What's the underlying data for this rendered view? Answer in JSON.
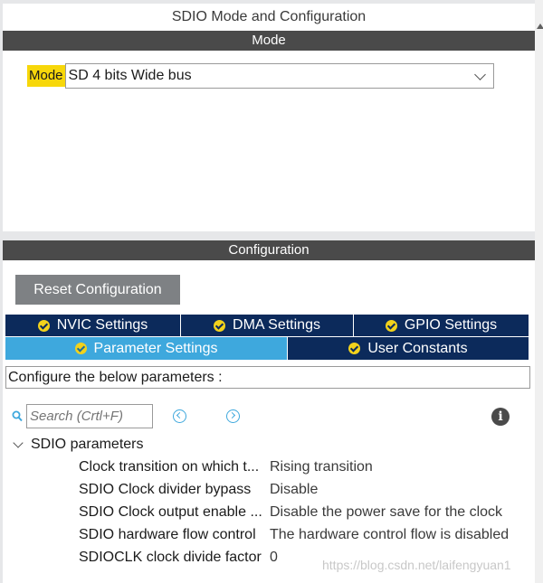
{
  "window": {
    "title": "SDIO Mode and Configuration"
  },
  "mode_section": {
    "header": "Mode",
    "label": "Mode",
    "selected": "SD 4 bits Wide bus"
  },
  "config_section": {
    "header": "Configuration",
    "reset_label": "Reset Configuration",
    "tabs_row1": [
      {
        "label": "NVIC Settings"
      },
      {
        "label": "DMA Settings"
      },
      {
        "label": "GPIO Settings"
      }
    ],
    "tabs_row2": [
      {
        "label": "Parameter Settings",
        "active": true
      },
      {
        "label": "User Constants"
      }
    ],
    "info_text": "Configure the below parameters :",
    "search_placeholder": "Search (Crtl+F)",
    "group": "SDIO parameters",
    "params": [
      {
        "name": "Clock transition on which t...",
        "value": "Rising transition"
      },
      {
        "name": "SDIO Clock divider bypass",
        "value": "Disable"
      },
      {
        "name": "SDIO Clock output enable ...",
        "value": "Disable the power save for the clock"
      },
      {
        "name": "SDIO hardware flow control",
        "value": "The hardware control flow is disabled"
      },
      {
        "name": "SDIOCLK clock divide factor",
        "value": "0"
      }
    ]
  },
  "watermark": "https://blog.csdn.net/laifengyuan1",
  "colors": {
    "dark_navy": "#0c2a5b",
    "active_tab": "#3ea8dd",
    "highlight_yellow": "#f7d70a",
    "section_bar": "#4a4a4a",
    "button_gray": "#7e8184"
  },
  "icons": [
    "check-circle-icon",
    "search-icon",
    "prev-arrow-icon",
    "next-arrow-icon",
    "info-icon",
    "chevron-down-icon"
  ]
}
